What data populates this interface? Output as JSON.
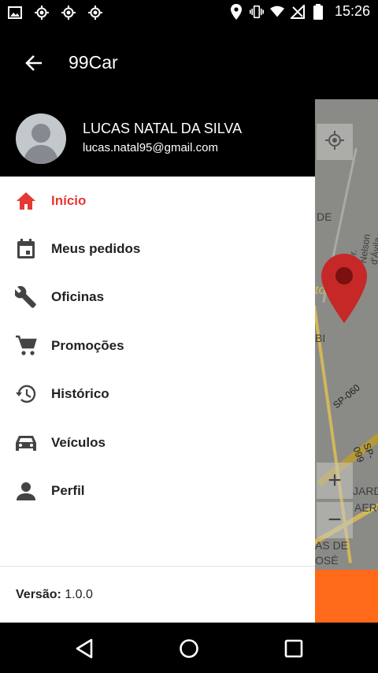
{
  "status_bar": {
    "time": "15:26",
    "left_icons": [
      "image-icon",
      "gps-icon",
      "gps-icon",
      "gps-icon"
    ],
    "right_icons": [
      "location-pin-icon",
      "vibrate-icon",
      "wifi-icon",
      "no-signal-icon",
      "battery-icon"
    ]
  },
  "appbar": {
    "title": "99Car"
  },
  "user": {
    "name": "LUCAS NATAL DA SILVA",
    "email": "lucas.natal95@gmail.com"
  },
  "menu": [
    {
      "label": "Início",
      "icon": "home-icon",
      "active": true
    },
    {
      "label": "Meus pedidos",
      "icon": "calendar-icon",
      "active": false
    },
    {
      "label": "Oficinas",
      "icon": "wrench-icon",
      "active": false
    },
    {
      "label": "Promoções",
      "icon": "cart-icon",
      "active": false
    },
    {
      "label": "Histórico",
      "icon": "history-icon",
      "active": false
    },
    {
      "label": "Veículos",
      "icon": "car-icon",
      "active": false
    },
    {
      "label": "Perfil",
      "icon": "person-icon",
      "active": false
    }
  ],
  "version": {
    "label": "Versão:",
    "value": "1.0.0"
  },
  "map": {
    "labels": [
      "DE",
      "Dr. Nelson d'Ávila",
      "to",
      "BI",
      "SP-060",
      "SP-099",
      "JARD",
      "AEROP",
      "AS DE",
      "OSÉ"
    ],
    "controls": {
      "zoom_in": "+",
      "zoom_out": "−"
    }
  },
  "colors": {
    "accent": "#e53935",
    "orange": "#ff6a1a",
    "pin": "#c62828"
  }
}
